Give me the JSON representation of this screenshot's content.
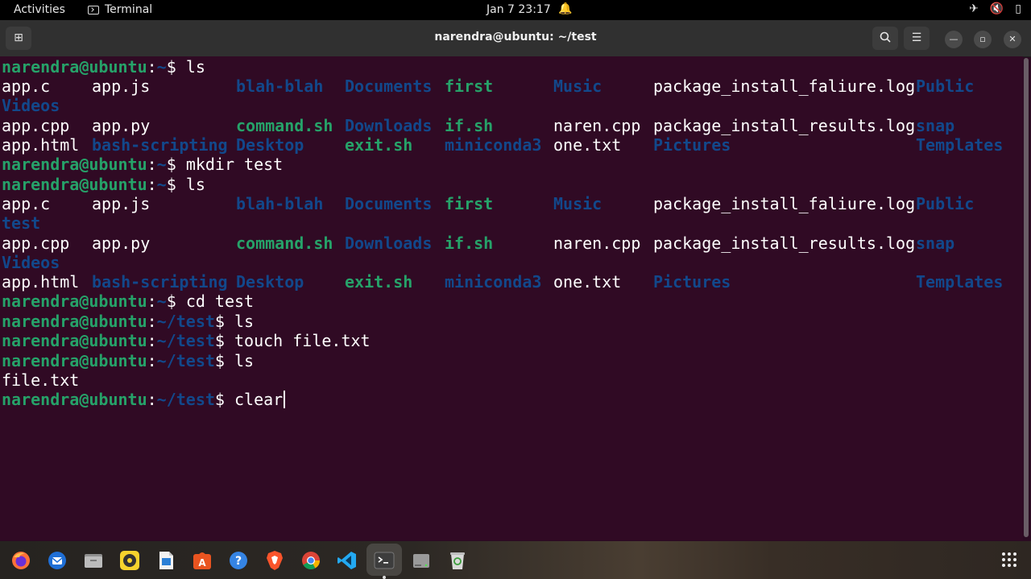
{
  "topbar": {
    "activities": "Activities",
    "app_name": "Terminal",
    "clock": "Jan 7  23:17",
    "icons": [
      "notification-bell-icon",
      "airplane-mode-icon",
      "volume-muted-icon",
      "battery-icon"
    ]
  },
  "window": {
    "title": "narendra@ubuntu: ~/test",
    "new_tab_icon": "new-tab-icon",
    "search_icon": "search-icon",
    "menu_icon": "hamburger-menu-icon",
    "minimize_icon": "minimize-icon",
    "maximize_icon": "maximize-icon",
    "close_icon": "close-icon"
  },
  "terminal": {
    "user_host": "narendra@ubuntu",
    "prompts": [
      {
        "path": "~",
        "command": "ls"
      },
      {
        "path": "~",
        "command": "mkdir test"
      },
      {
        "path": "~",
        "command": "ls"
      },
      {
        "path": "~",
        "command": "cd test"
      },
      {
        "path": "~/test",
        "command": "ls"
      },
      {
        "path": "~/test",
        "command": "touch file.txt"
      },
      {
        "path": "~/test",
        "command": "ls"
      },
      {
        "path": "~/test",
        "command": "clear"
      }
    ],
    "ls_output_1": {
      "row1": [
        "app.c",
        "app.js",
        "blah-blah",
        "Documents",
        "first",
        "Music",
        "package_install_faliure.log",
        "Public"
      ],
      "row1b": "Videos",
      "row2": [
        "app.cpp",
        "app.py",
        "command.sh",
        "Downloads",
        "if.sh",
        "naren.cpp",
        "package_install_results.log",
        "snap"
      ],
      "row3": [
        "app.html",
        "bash-scripting",
        "Desktop",
        "exit.sh",
        "miniconda3",
        "one.txt",
        "Pictures",
        "Templates"
      ]
    },
    "ls_output_2": {
      "row1": [
        "app.c",
        "app.js",
        "blah-blah",
        "Documents",
        "first",
        "Music",
        "package_install_faliure.log",
        "Public"
      ],
      "row1b": "test",
      "row2": [
        "app.cpp",
        "app.py",
        "command.sh",
        "Downloads",
        "if.sh",
        "naren.cpp",
        "package_install_results.log",
        "snap"
      ],
      "row2b": "Videos",
      "row3": [
        "app.html",
        "bash-scripting",
        "Desktop",
        "exit.sh",
        "miniconda3",
        "one.txt",
        "Pictures",
        "Templates"
      ]
    },
    "ls_output_3": "file.txt",
    "colors": {
      "background": "#300a24",
      "user": "#26a269",
      "directory": "#12488b",
      "executable": "#26a269",
      "file": "#ffffff"
    }
  },
  "dock": {
    "apps": [
      "firefox-icon",
      "thunderbird-icon",
      "files-icon",
      "rhythmbox-icon",
      "libreoffice-writer-icon",
      "software-center-icon",
      "help-icon",
      "brave-icon",
      "chrome-icon",
      "vscode-icon",
      "terminal-icon",
      "disks-icon",
      "trash-icon"
    ],
    "show_apps_icon": "show-applications-icon"
  }
}
